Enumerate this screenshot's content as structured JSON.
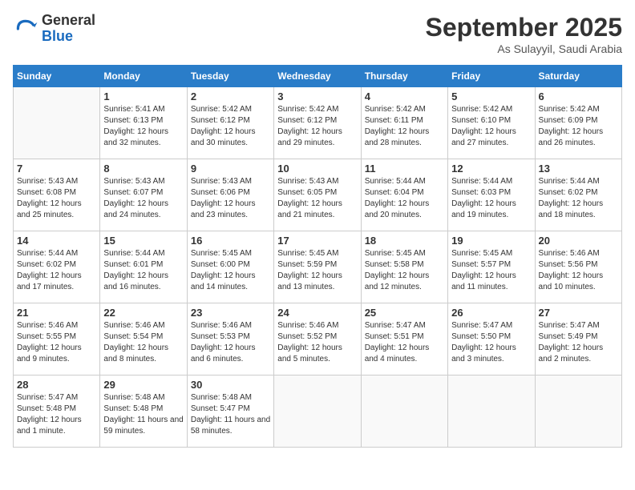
{
  "logo": {
    "general": "General",
    "blue": "Blue"
  },
  "title": "September 2025",
  "location": "As Sulayyil, Saudi Arabia",
  "days_of_week": [
    "Sunday",
    "Monday",
    "Tuesday",
    "Wednesday",
    "Thursday",
    "Friday",
    "Saturday"
  ],
  "weeks": [
    [
      {
        "day": "",
        "info": ""
      },
      {
        "day": "1",
        "sunrise": "5:41 AM",
        "sunset": "6:13 PM",
        "daylight": "12 hours and 32 minutes."
      },
      {
        "day": "2",
        "sunrise": "5:42 AM",
        "sunset": "6:12 PM",
        "daylight": "12 hours and 30 minutes."
      },
      {
        "day": "3",
        "sunrise": "5:42 AM",
        "sunset": "6:12 PM",
        "daylight": "12 hours and 29 minutes."
      },
      {
        "day": "4",
        "sunrise": "5:42 AM",
        "sunset": "6:11 PM",
        "daylight": "12 hours and 28 minutes."
      },
      {
        "day": "5",
        "sunrise": "5:42 AM",
        "sunset": "6:10 PM",
        "daylight": "12 hours and 27 minutes."
      },
      {
        "day": "6",
        "sunrise": "5:42 AM",
        "sunset": "6:09 PM",
        "daylight": "12 hours and 26 minutes."
      }
    ],
    [
      {
        "day": "7",
        "sunrise": "5:43 AM",
        "sunset": "6:08 PM",
        "daylight": "12 hours and 25 minutes."
      },
      {
        "day": "8",
        "sunrise": "5:43 AM",
        "sunset": "6:07 PM",
        "daylight": "12 hours and 24 minutes."
      },
      {
        "day": "9",
        "sunrise": "5:43 AM",
        "sunset": "6:06 PM",
        "daylight": "12 hours and 23 minutes."
      },
      {
        "day": "10",
        "sunrise": "5:43 AM",
        "sunset": "6:05 PM",
        "daylight": "12 hours and 21 minutes."
      },
      {
        "day": "11",
        "sunrise": "5:44 AM",
        "sunset": "6:04 PM",
        "daylight": "12 hours and 20 minutes."
      },
      {
        "day": "12",
        "sunrise": "5:44 AM",
        "sunset": "6:03 PM",
        "daylight": "12 hours and 19 minutes."
      },
      {
        "day": "13",
        "sunrise": "5:44 AM",
        "sunset": "6:02 PM",
        "daylight": "12 hours and 18 minutes."
      }
    ],
    [
      {
        "day": "14",
        "sunrise": "5:44 AM",
        "sunset": "6:02 PM",
        "daylight": "12 hours and 17 minutes."
      },
      {
        "day": "15",
        "sunrise": "5:44 AM",
        "sunset": "6:01 PM",
        "daylight": "12 hours and 16 minutes."
      },
      {
        "day": "16",
        "sunrise": "5:45 AM",
        "sunset": "6:00 PM",
        "daylight": "12 hours and 14 minutes."
      },
      {
        "day": "17",
        "sunrise": "5:45 AM",
        "sunset": "5:59 PM",
        "daylight": "12 hours and 13 minutes."
      },
      {
        "day": "18",
        "sunrise": "5:45 AM",
        "sunset": "5:58 PM",
        "daylight": "12 hours and 12 minutes."
      },
      {
        "day": "19",
        "sunrise": "5:45 AM",
        "sunset": "5:57 PM",
        "daylight": "12 hours and 11 minutes."
      },
      {
        "day": "20",
        "sunrise": "5:46 AM",
        "sunset": "5:56 PM",
        "daylight": "12 hours and 10 minutes."
      }
    ],
    [
      {
        "day": "21",
        "sunrise": "5:46 AM",
        "sunset": "5:55 PM",
        "daylight": "12 hours and 9 minutes."
      },
      {
        "day": "22",
        "sunrise": "5:46 AM",
        "sunset": "5:54 PM",
        "daylight": "12 hours and 8 minutes."
      },
      {
        "day": "23",
        "sunrise": "5:46 AM",
        "sunset": "5:53 PM",
        "daylight": "12 hours and 6 minutes."
      },
      {
        "day": "24",
        "sunrise": "5:46 AM",
        "sunset": "5:52 PM",
        "daylight": "12 hours and 5 minutes."
      },
      {
        "day": "25",
        "sunrise": "5:47 AM",
        "sunset": "5:51 PM",
        "daylight": "12 hours and 4 minutes."
      },
      {
        "day": "26",
        "sunrise": "5:47 AM",
        "sunset": "5:50 PM",
        "daylight": "12 hours and 3 minutes."
      },
      {
        "day": "27",
        "sunrise": "5:47 AM",
        "sunset": "5:49 PM",
        "daylight": "12 hours and 2 minutes."
      }
    ],
    [
      {
        "day": "28",
        "sunrise": "5:47 AM",
        "sunset": "5:48 PM",
        "daylight": "12 hours and 1 minute."
      },
      {
        "day": "29",
        "sunrise": "5:48 AM",
        "sunset": "5:48 PM",
        "daylight": "11 hours and 59 minutes."
      },
      {
        "day": "30",
        "sunrise": "5:48 AM",
        "sunset": "5:47 PM",
        "daylight": "11 hours and 58 minutes."
      },
      {
        "day": "",
        "info": ""
      },
      {
        "day": "",
        "info": ""
      },
      {
        "day": "",
        "info": ""
      },
      {
        "day": "",
        "info": ""
      }
    ]
  ]
}
